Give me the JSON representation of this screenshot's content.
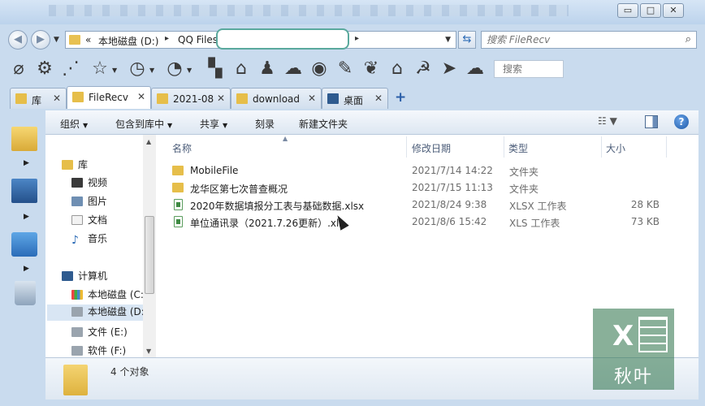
{
  "window": {
    "minimize_glyph": "▭",
    "maximize_glyph": "□",
    "close_glyph": "✕"
  },
  "address": {
    "overflow": "«",
    "crumb_drive": "本地磁盘 (D:)",
    "crumb_sep": "▸",
    "crumb_folder": "QQ Files",
    "end_sep": "▸"
  },
  "search": {
    "placeholder": "搜索 FileRecv"
  },
  "toolbar": {
    "search_placeholder": "搜索",
    "icons": [
      "paperclip-icon",
      "gear-icon",
      "share-icon",
      "star-icon",
      "clock-icon",
      "dial-icon",
      "apps-icon",
      "home-icon",
      "qq-icon",
      "wechat-icon",
      "chrome-icon",
      "pen-icon",
      "lungs-icon",
      "plus-home-icon",
      "hammer-sickle-icon",
      "send-icon",
      "cloud-icon"
    ]
  },
  "tabs": [
    {
      "label": "库",
      "active": false
    },
    {
      "label": "FileRecv",
      "active": true
    },
    {
      "label": "2021-08",
      "active": false
    },
    {
      "label": "download",
      "active": false
    },
    {
      "label": "桌面",
      "active": false
    }
  ],
  "tab_add": "+",
  "commands": {
    "organize": "组织",
    "include_library": "包含到库中",
    "share": "共享",
    "burn": "刻录",
    "new_folder": "新建文件夹"
  },
  "nav": {
    "library": "库",
    "videos": "视频",
    "pictures": "图片",
    "documents": "文档",
    "music": "音乐",
    "computer": "计算机",
    "drive_c": "本地磁盘 (C:",
    "drive_d": "本地磁盘 (D:",
    "drive_e": "文件 (E:)",
    "drive_f": "软件 (F:)"
  },
  "columns": {
    "name": "名称",
    "modified": "修改日期",
    "type": "类型",
    "size": "大小"
  },
  "files": [
    {
      "name": "MobileFile",
      "date": "2021/7/14 14:22",
      "type": "文件夹",
      "size": "",
      "kind": "folder"
    },
    {
      "name": "龙华区第七次普查概况",
      "date": "2021/7/15 11:13",
      "type": "文件夹",
      "size": "",
      "kind": "folder"
    },
    {
      "name": "2020年数据填报分工表与基础数据.xlsx",
      "date": "2021/8/24 9:38",
      "type": "XLSX 工作表",
      "size": "28 KB",
      "kind": "xls"
    },
    {
      "name": "单位通讯录（2021.7.26更新）.xls",
      "date": "2021/8/6 15:42",
      "type": "XLS 工作表",
      "size": "73 KB",
      "kind": "xls"
    }
  ],
  "status": {
    "count": "4 个对象"
  },
  "watermark": {
    "letter": "X",
    "text": "秋叶"
  },
  "colors": {
    "folder": "#e6be4a",
    "accent": "#2a5ea8",
    "excel_green": "#3f8a43"
  }
}
